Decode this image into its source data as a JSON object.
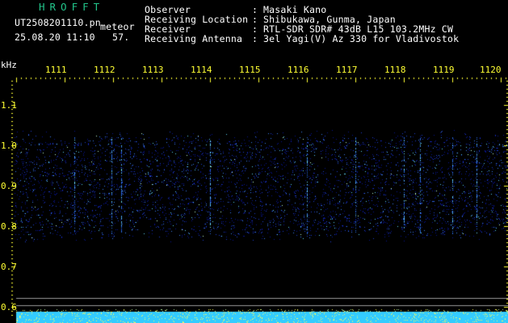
{
  "station": {
    "logo": "HROFFT",
    "filename": "UT2508201110.pn",
    "type": "meteor",
    "date_time": "25.08.20 11:10",
    "count": "57."
  },
  "info": {
    "labels": [
      "Observer",
      "Receiving Location",
      "Receiver",
      "Receiving Antenna"
    ],
    "values": [
      "Masaki Kano",
      "Shibukawa, Gunma, Japan",
      "RTL-SDR SDR# 43dB L15 103.2MHz CW",
      "3el Yagi(V) Az 330 for Vladivostok"
    ]
  },
  "axis": {
    "unit": "kHz",
    "y_ticks": [
      "1.1",
      "1.0",
      "0.9",
      "0.8",
      "0.7",
      "0.6"
    ],
    "time_ticks": [
      "1111",
      "1112",
      "1113",
      "1114",
      "1115",
      "1116",
      "1117",
      "1118",
      "1119",
      "1120"
    ]
  },
  "colors": {
    "background": "#000000",
    "header_text": "#ffffff",
    "logo": "#22c48a",
    "axis_text": "#ffff33",
    "noise_band": "#1a2aa0",
    "bottom_strip": "#33ccff"
  }
}
